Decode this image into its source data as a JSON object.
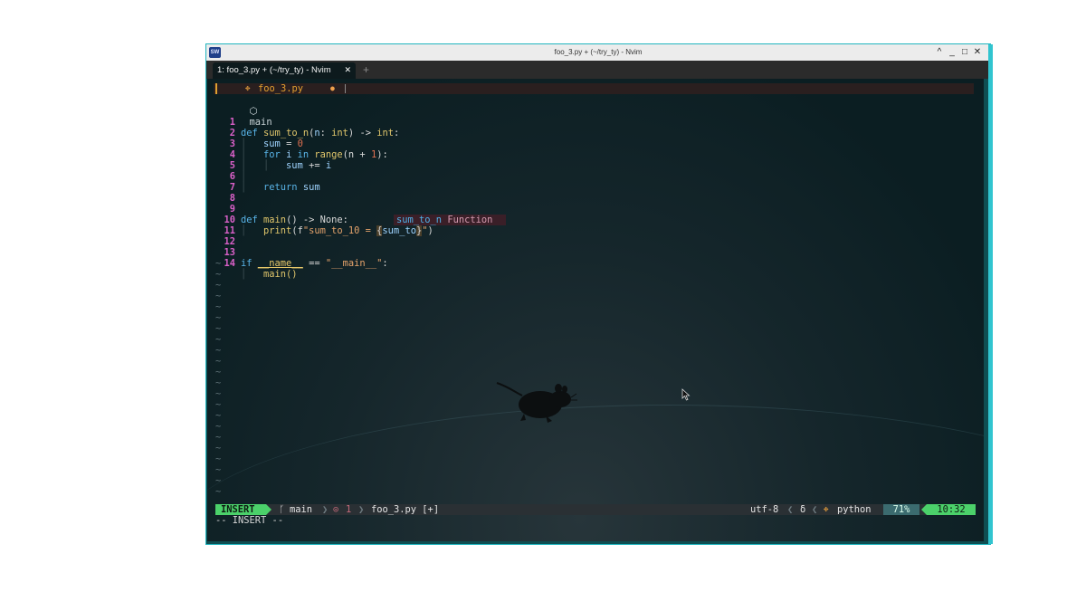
{
  "window": {
    "title": "foo_3.py + (~/try_ty) - Nvim",
    "app_icon_text": "SW",
    "controls": [
      "^",
      "_",
      "□",
      "✕"
    ]
  },
  "tabs": [
    {
      "label": "1: foo_3.py + (~/try_ty) - Nvim",
      "close": "✕"
    }
  ],
  "new_tab": "+",
  "buffer": {
    "icon": "python-icon",
    "name": "foo_3.py",
    "modified": "●"
  },
  "context": {
    "icon": "cube-icon",
    "label": "main"
  },
  "code": {
    "l1": {
      "n": "1",
      "def": "def",
      "name": "sum_to_n",
      "p1": "(",
      "param": "n",
      "colon": ": ",
      "ptype": "int",
      "p2": ") ",
      "arrow": "->",
      "sp": " ",
      "rtype": "int",
      "end": ":"
    },
    "l2": {
      "n": "2",
      "id": "sum",
      "op": " = ",
      "val": "0"
    },
    "l3": {
      "n": "3",
      "for": "for",
      "var": " i ",
      "in": "in",
      "sp": " ",
      "range": "range",
      "args": "(n + ",
      "one": "1",
      "end": "):"
    },
    "l4": {
      "n": "4",
      "id": "sum",
      "op": " += ",
      "var": "i"
    },
    "l5": {
      "n": "5"
    },
    "l6": {
      "n": "6",
      "ret": "return",
      "val": " sum"
    },
    "l7": {
      "n": "7"
    },
    "l8": {
      "n": "8"
    },
    "l9": {
      "n": "9",
      "def": "def",
      "name": " main",
      "rest": "() -> None:"
    },
    "l10": {
      "n": "10",
      "print": "print",
      "p1": "(f",
      "str": "\"sum_to_10 = ",
      "brace1": "{",
      "typed": "sum_to",
      "brace2": "}",
      "strend": "\"",
      "end": ")"
    },
    "l11": {
      "n": "11"
    },
    "l12": {
      "n": "12"
    },
    "l13": {
      "n": "13",
      "if": "if",
      "sp": " ",
      "dunder": "__name__",
      "op": " == ",
      "str": "\"__main__\"",
      "end": ":"
    },
    "l14": {
      "n": "14",
      "call": "main()"
    }
  },
  "completion": {
    "name": "sum_to_n",
    "kind": "Function"
  },
  "tilde": "~",
  "statusline": {
    "mode": "INSERT",
    "branch_icon": "git-branch-icon",
    "branch": "main",
    "diagnostics_icon": "⊙",
    "diagnostics": "1",
    "file": "foo_3.py [+]",
    "encoding": "utf-8",
    "delta": "δ",
    "filetype_icon": "python-icon",
    "filetype": "python",
    "percent": "71%",
    "position": "10:32"
  },
  "cmdline": "-- INSERT --"
}
